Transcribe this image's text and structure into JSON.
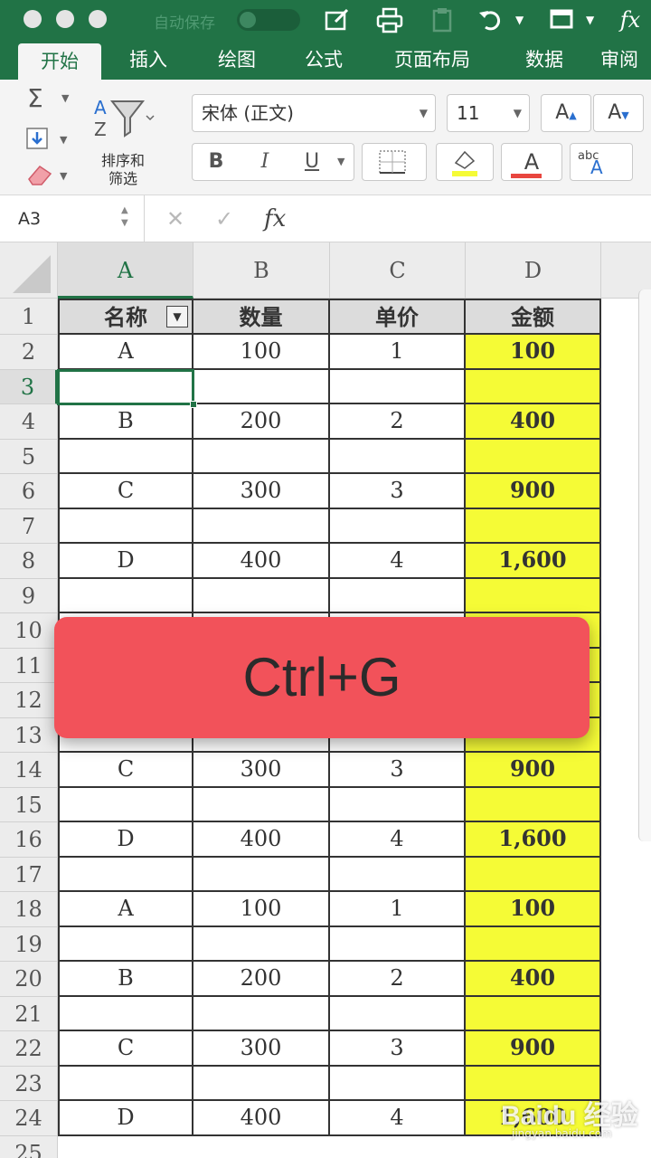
{
  "titlebar": {
    "autosave_label": "自动保存",
    "icons": [
      "edit-icon",
      "print-icon",
      "paste-icon",
      "undo-icon",
      "view-icon",
      "function-icon"
    ],
    "fx_label": "fx"
  },
  "tabs": [
    "开始",
    "插入",
    "绘图",
    "公式",
    "页面布局",
    "数据",
    "审阅"
  ],
  "ribbon": {
    "sum_glyph": "Σ",
    "sort_filter_label_line1": "排序和",
    "sort_filter_label_line2": "筛选",
    "font_name": "宋体 (正文)",
    "font_size": "11",
    "grow_font": "A",
    "shrink_font": "A",
    "bold": "B",
    "italic": "I",
    "underline": "U",
    "font_color_letter": "A",
    "wrap_label": "abc"
  },
  "formula_bar": {
    "name_box": "A3",
    "cancel": "✕",
    "confirm": "✓",
    "fx": "fx",
    "value": ""
  },
  "columns": [
    "A",
    "B",
    "C",
    "D"
  ],
  "rows": [
    "1",
    "2",
    "3",
    "4",
    "5",
    "6",
    "7",
    "8",
    "9",
    "10",
    "11",
    "12",
    "13",
    "14",
    "15",
    "16",
    "17",
    "18",
    "19",
    "20",
    "21",
    "22",
    "23",
    "24",
    "25"
  ],
  "table": {
    "headers": [
      "名称",
      "数量",
      "单价",
      "金额"
    ],
    "rows": [
      [
        "A",
        "100",
        "1",
        "100"
      ],
      [
        "",
        "",
        "",
        ""
      ],
      [
        "B",
        "200",
        "2",
        "400"
      ],
      [
        "",
        "",
        "",
        ""
      ],
      [
        "C",
        "300",
        "3",
        "900"
      ],
      [
        "",
        "",
        "",
        ""
      ],
      [
        "D",
        "400",
        "4",
        "1,600"
      ],
      [
        "",
        "",
        "",
        ""
      ],
      [
        "",
        "",
        "",
        ""
      ],
      [
        "",
        "",
        "",
        ""
      ],
      [
        "",
        "",
        "",
        ""
      ],
      [
        "",
        "",
        "",
        ""
      ],
      [
        "C",
        "300",
        "3",
        "900"
      ],
      [
        "",
        "",
        "",
        ""
      ],
      [
        "D",
        "400",
        "4",
        "1,600"
      ],
      [
        "",
        "",
        "",
        ""
      ],
      [
        "A",
        "100",
        "1",
        "100"
      ],
      [
        "",
        "",
        "",
        ""
      ],
      [
        "B",
        "200",
        "2",
        "400"
      ],
      [
        "",
        "",
        "",
        ""
      ],
      [
        "C",
        "300",
        "3",
        "900"
      ],
      [
        "",
        "",
        "",
        ""
      ],
      [
        "D",
        "400",
        "4",
        "1,600"
      ]
    ]
  },
  "active_cell": "A3",
  "colors": {
    "accent": "#217346",
    "highlight": "#f5fb36",
    "banner": "#f2525a"
  },
  "overlay": {
    "shortcut": "Ctrl+G"
  },
  "watermark": {
    "brand": "Baidu 经验",
    "sub": "jingyan.baidu.com"
  }
}
